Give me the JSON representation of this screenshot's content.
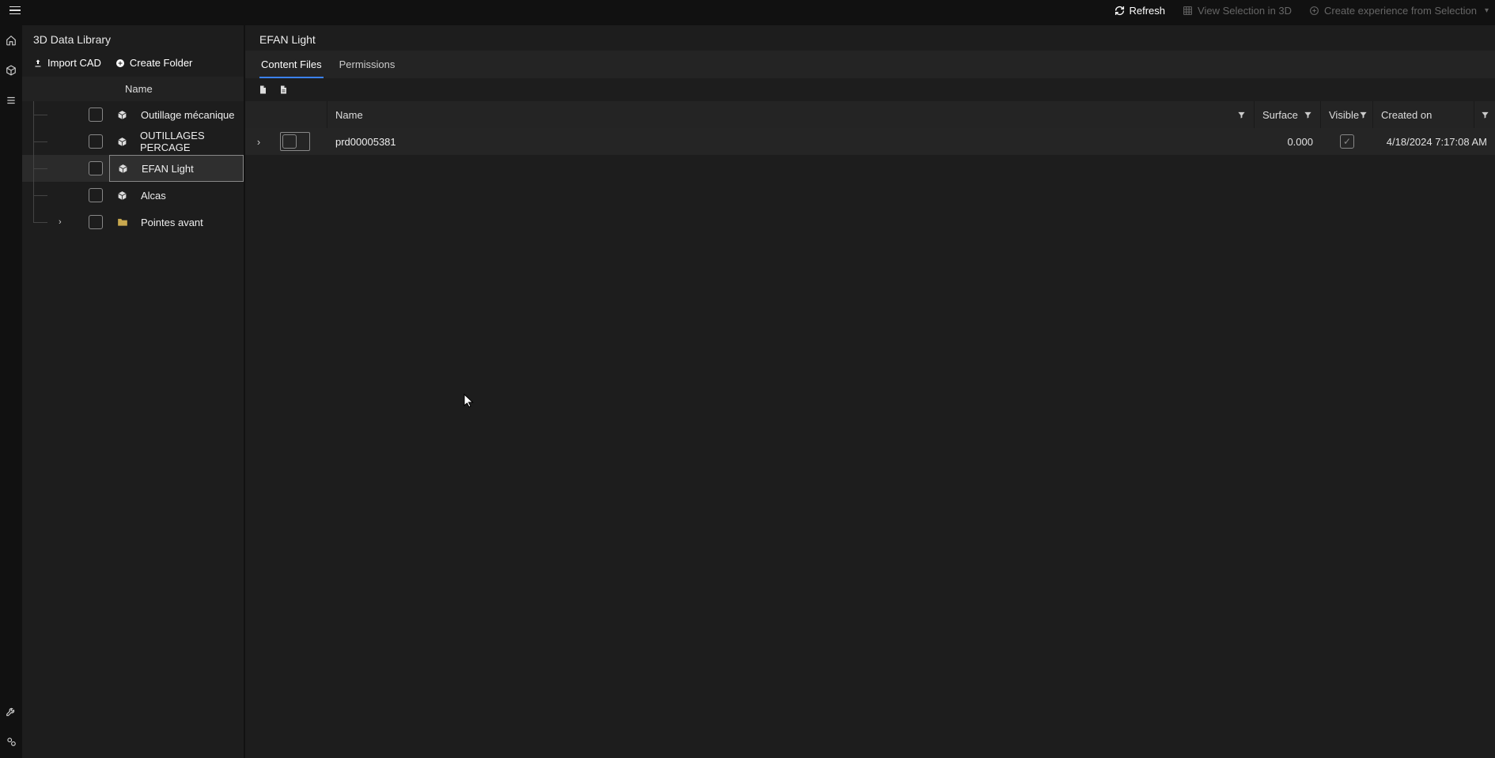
{
  "topbar": {
    "refresh": "Refresh",
    "view3d": "View Selection in 3D",
    "createExp": "Create experience from Selection"
  },
  "library": {
    "title": "3D Data Library",
    "importCad": "Import CAD",
    "createFolder": "Create Folder",
    "colName": "Name",
    "items": [
      {
        "label": "Outillage mécanique",
        "type": "cube",
        "selected": false,
        "chevron": false,
        "last": false
      },
      {
        "label": "OUTILLAGES PERCAGE",
        "type": "cube",
        "selected": false,
        "chevron": false,
        "last": false
      },
      {
        "label": "EFAN Light",
        "type": "cube",
        "selected": true,
        "chevron": false,
        "last": false
      },
      {
        "label": "Alcas",
        "type": "cube",
        "selected": false,
        "chevron": false,
        "last": false
      },
      {
        "label": "Pointes avant",
        "type": "folder",
        "selected": false,
        "chevron": true,
        "last": true
      }
    ]
  },
  "content": {
    "title": "EFAN Light",
    "tabs": {
      "contentFiles": "Content Files",
      "permissions": "Permissions"
    },
    "columns": {
      "name": "Name",
      "surface": "Surface",
      "visible": "Visible",
      "created": "Created on"
    },
    "rows": [
      {
        "name": "prd00005381",
        "surface": "0.000",
        "visible": true,
        "created": "4/18/2024 7:17:08 AM"
      }
    ]
  }
}
